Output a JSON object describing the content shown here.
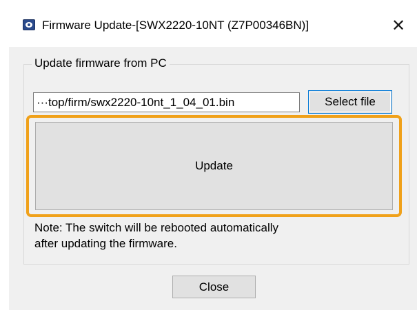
{
  "window": {
    "title": "Firmware Update-[SWX2220-10NT (Z7P00346BN)]",
    "close_glyph": "✕",
    "app_icon": "app-monitor-icon"
  },
  "group": {
    "legend": "Update firmware from PC",
    "file_path": "···top/firm/swx2220-10nt_1_04_01.bin",
    "select_file_label": "Select file",
    "update_label": "Update",
    "note_line1": "Note: The switch will be rebooted automatically",
    "note_line2": "after updating the firmware."
  },
  "footer": {
    "close_label": "Close"
  },
  "colors": {
    "highlight": "#f0a11a",
    "focus_border": "#0078d7",
    "dialog_bg": "#f0f0f0"
  }
}
